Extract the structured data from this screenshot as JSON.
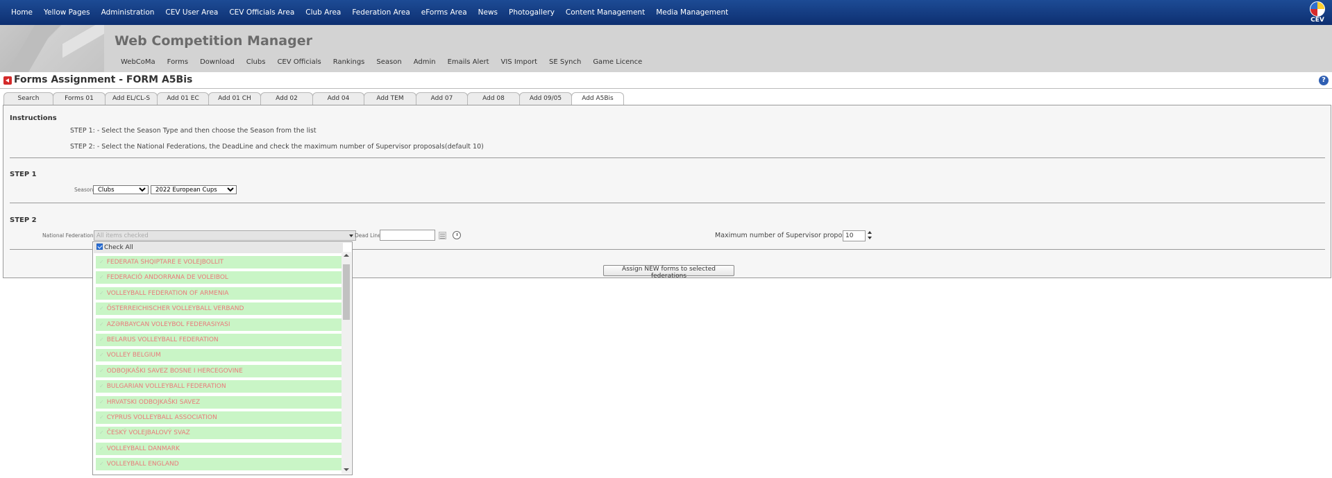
{
  "topnav": {
    "items": [
      "Home",
      "Yellow Pages",
      "Administration",
      "CEV User Area",
      "CEV Officials Area",
      "Club Area",
      "Federation Area",
      "eForms Area",
      "News",
      "Photogallery",
      "Content Management",
      "Media Management"
    ],
    "logo_text": "CEV"
  },
  "banner": {
    "title": "Web Competition Manager",
    "subnav": [
      "WebCoMa",
      "Forms",
      "Download",
      "Clubs",
      "CEV Officials",
      "Rankings",
      "Season",
      "Admin",
      "Emails Alert",
      "VIS Import",
      "SE Synch",
      "Game Licence"
    ]
  },
  "page": {
    "title": "Forms Assignment - FORM A5Bis",
    "help_symbol": "?"
  },
  "tabs": [
    "Search",
    "Forms 01",
    "Add EL/CL-S",
    "Add 01 EC",
    "Add 01 CH",
    "Add 02",
    "Add 04",
    "Add TEM",
    "Add 07",
    "Add 08",
    "Add 09/05",
    "Add A5Bis"
  ],
  "active_tab": "Add A5Bis",
  "instructions": {
    "heading": "Instructions",
    "step1": "STEP 1: - Select the Season Type and then choose the Season from the list",
    "step2": "STEP 2: - Select the National Federations, the DeadLine and check the maximum number of Supervisor proposals(default 10)"
  },
  "step1": {
    "heading": "STEP 1",
    "season_label": "Season:",
    "season_type": "Clubs",
    "season_value": "2022 European Cups"
  },
  "step2": {
    "heading": "STEP 2",
    "nf_label": "National Federations:",
    "nf_placeholder": "All items checked",
    "deadline_label": "Dead Line:",
    "deadline_value": "",
    "max_label": "Maximum number of Supervisor proposals",
    "max_value": "10",
    "assign_button": "Assign NEW forms to selected federations"
  },
  "dropdown": {
    "check_all": "Check All",
    "check_symbol": "✓",
    "items": [
      "FEDERATA SHQIPTARE E VOLEJBOLLIT",
      "FEDERACIÓ ANDORRANA DE VOLEIBOL",
      "VOLLEYBALL FEDERATION OF ARMENIA",
      "ÖSTERREICHISCHER VOLLEYBALL VERBAND",
      "AZƏRBAYCAN VOLEYBOL FEDERASIYASI",
      "BELARUS VOLLEYBALL FEDERATION",
      "VOLLEY BELGIUM",
      "ODBOJKAŠKI SAVEZ BOSNE I HERCEGOVINE",
      "BULGARIAN VOLLEYBALL FEDERATION",
      "HRVATSKI ODBOJKAŠKI SAVEZ",
      "CYPRUS VOLLEYBALL ASSOCIATION",
      "ČESKÝ VOLEJBALOVÝ SVAZ",
      "VOLLEYBALL DANMARK",
      "VOLLEYBALL ENGLAND"
    ]
  },
  "colors": {
    "nav_bg": "#0d2f70",
    "banner_bg": "#d3d3d3",
    "item_bg": "#c9f5c6",
    "item_text": "#e97a7a"
  }
}
